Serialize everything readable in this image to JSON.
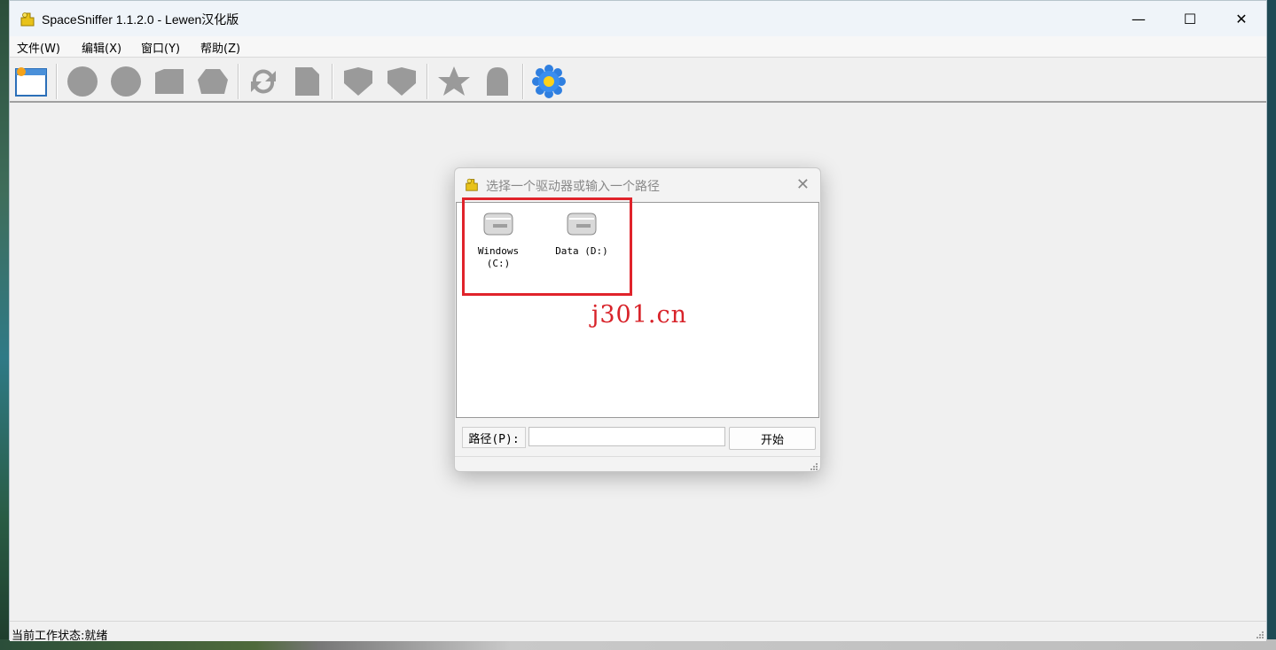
{
  "window": {
    "title": "SpaceSniffer 1.1.2.0 - Lewen汉化版",
    "minimize_glyph": "—",
    "maximize_glyph": "☐",
    "close_glyph": "✕"
  },
  "menu": [
    {
      "label": "文件(W)"
    },
    {
      "label": "编辑(X)"
    },
    {
      "label": "窗口(Y)"
    },
    {
      "label": "帮助(Z)"
    }
  ],
  "toolbar": {
    "icons": [
      "new-window-icon",
      "circle-icon",
      "circle-icon",
      "folder-icon",
      "hexagon-icon",
      "refresh-icon",
      "document-icon",
      "shield-icon",
      "shield-icon",
      "star-icon",
      "bell-icon",
      "settings-flower-icon"
    ]
  },
  "dialog": {
    "title": "选择一个驱动器或输入一个路径",
    "close_glyph": "✕",
    "drives": [
      {
        "label_line1": "Windows",
        "label_line2": "(C:)"
      },
      {
        "label_line1": "Data (D:)",
        "label_line2": ""
      }
    ],
    "path_label": "路径(P):",
    "path_value": "",
    "start_label": "开始"
  },
  "watermark": "j301.cn",
  "status": "当前工作状态:就绪",
  "colors": {
    "highlight": "#e0232b",
    "watermark": "#d8232a",
    "titlebar_bg": "#eff4f9"
  }
}
